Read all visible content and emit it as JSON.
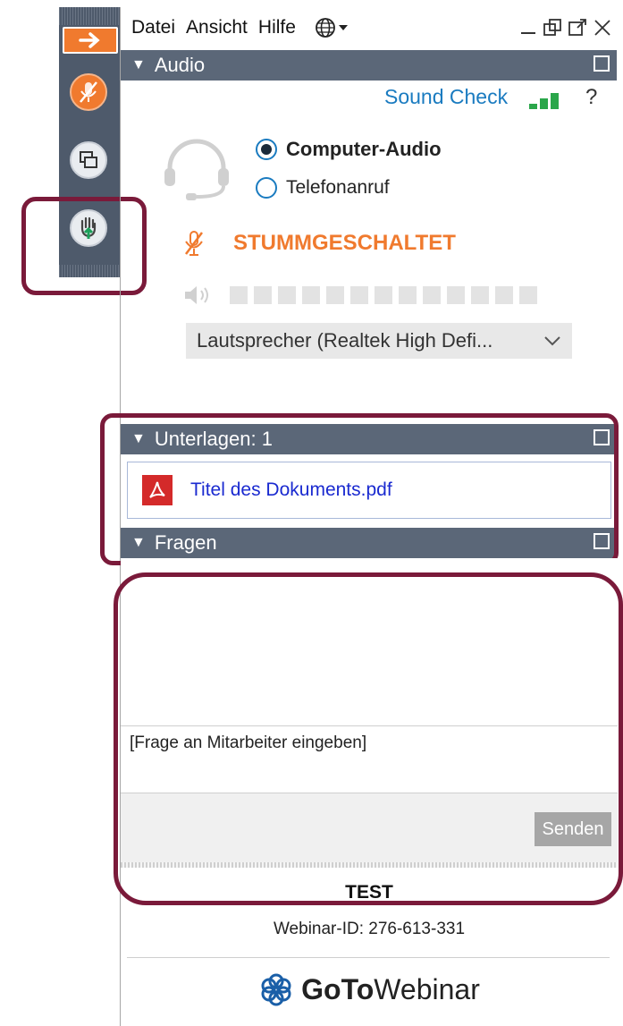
{
  "menu": {
    "file": "Datei",
    "view": "Ansicht",
    "help": "Hilfe"
  },
  "audio": {
    "header": "Audio",
    "sound_check": "Sound Check",
    "help": "?",
    "option_computer": "Computer-Audio",
    "option_phone": "Telefonanruf",
    "muted_label": "STUMMGESCHALTET",
    "speaker_select": "Lautsprecher (Realtek High Defi..."
  },
  "documents": {
    "header": "Unterlagen: 1",
    "file_name": "Titel des Dokuments.pdf"
  },
  "questions": {
    "header": "Fragen",
    "placeholder": "[Frage an Mitarbeiter eingeben]",
    "send_label": "Senden"
  },
  "footer": {
    "title": "TEST",
    "webinar_id": "Webinar-ID: 276-613-331",
    "brand_bold": "GoTo",
    "brand_light": "Webinar"
  },
  "colors": {
    "accent_orange": "#f07a2e",
    "section_bar": "#5b6778",
    "link_blue": "#1a7bc0",
    "highlight": "#7a1a3a"
  },
  "icons": [
    "arrow-right-icon",
    "mic-muted-icon",
    "screen-share-icon",
    "raise-hand-icon",
    "globe-icon",
    "minimize-icon",
    "restore-icon",
    "popout-icon",
    "close-icon",
    "headset-icon",
    "speaker-icon",
    "pdf-icon",
    "chevron-down-icon"
  ]
}
